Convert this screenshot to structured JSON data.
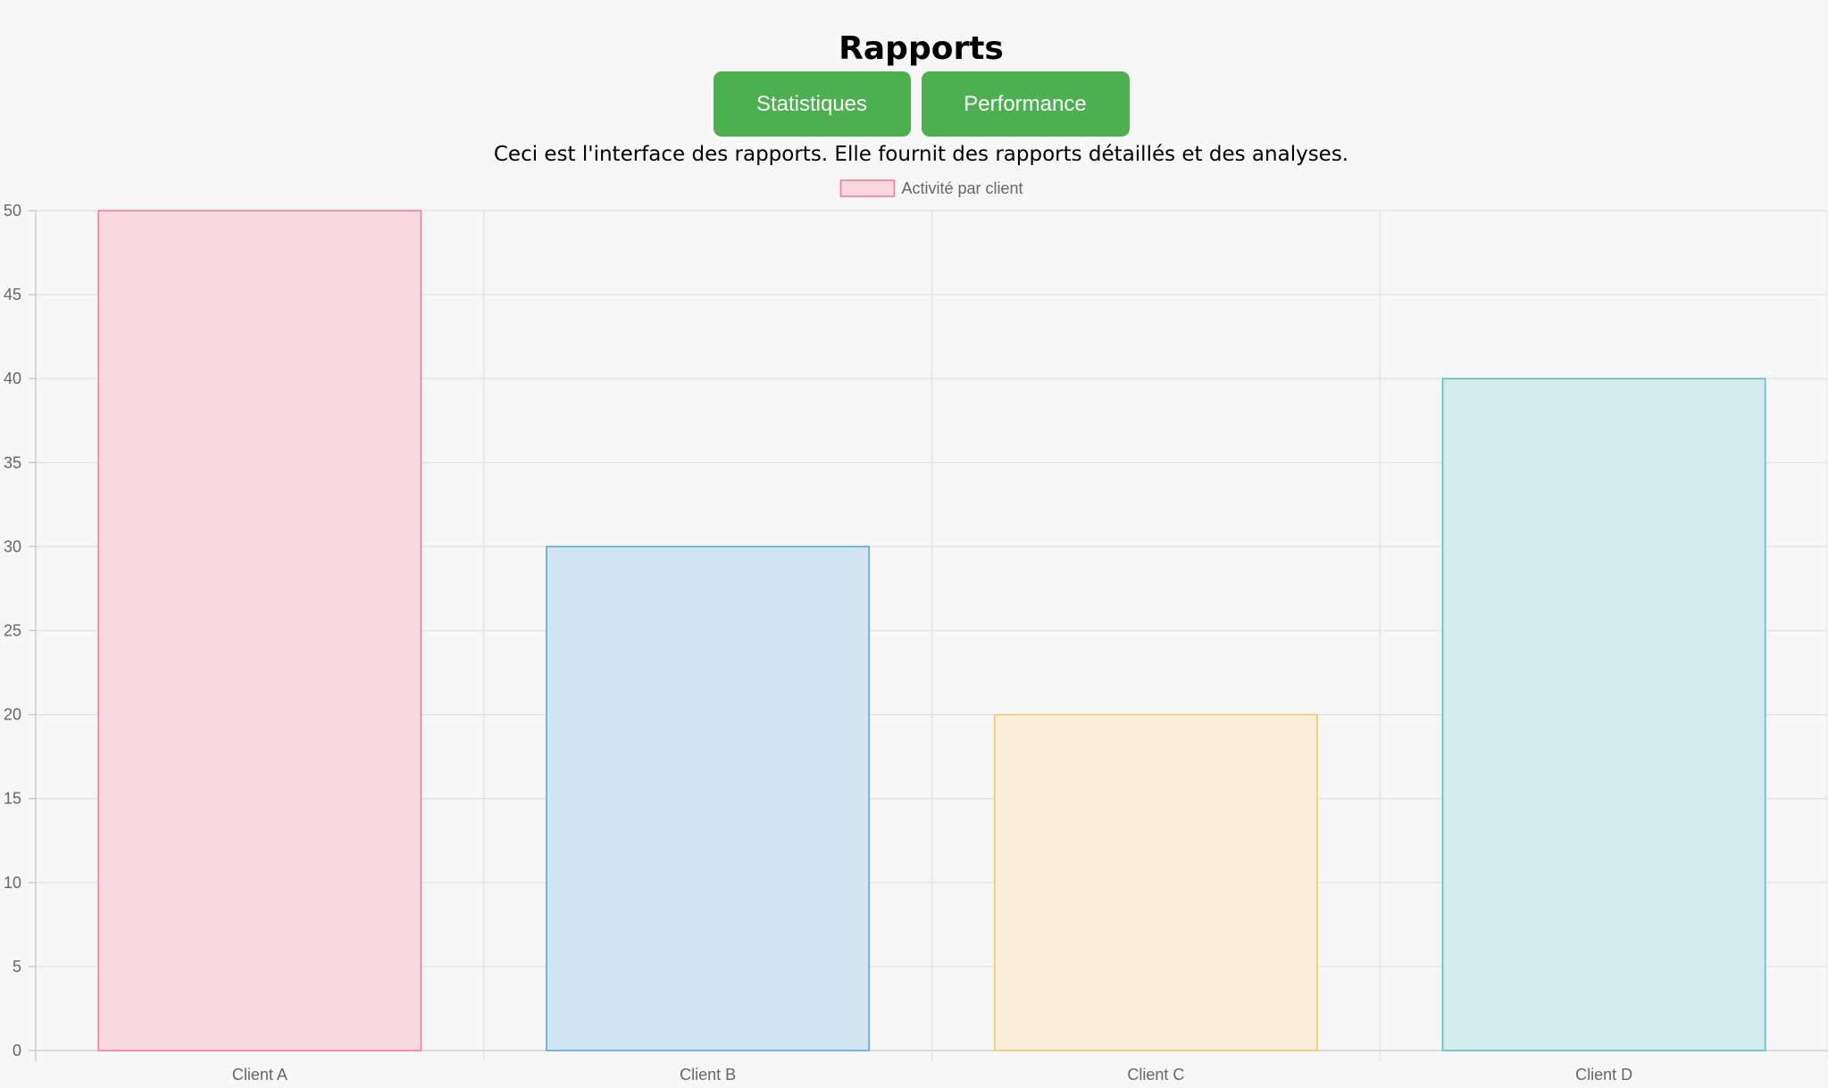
{
  "page": {
    "title": "Rapports",
    "description": "Ceci est l'interface des rapports. Elle fournit des rapports détaillés et des analyses."
  },
  "nav": {
    "statistics_label": "Statistiques",
    "performance_label": "Performance",
    "button_color": "#4caf50"
  },
  "chart_data": {
    "type": "bar",
    "categories": [
      "Client A",
      "Client B",
      "Client C",
      "Client D"
    ],
    "series": [
      {
        "name": "Activité par client",
        "values": [
          50,
          30,
          20,
          40
        ]
      }
    ],
    "bar_fill_colors": [
      "#f8d9e0",
      "#d1e5f3",
      "#f9eed9",
      "#d4ebec"
    ],
    "bar_border_colors": [
      "#f27d99",
      "#5aa8dc",
      "#f5c96a",
      "#5cbebf"
    ],
    "ylim": [
      0,
      50
    ],
    "y_ticks": [
      0,
      5,
      10,
      15,
      20,
      25,
      30,
      35,
      40,
      45,
      50
    ],
    "grid": true,
    "legend_position": "top"
  }
}
